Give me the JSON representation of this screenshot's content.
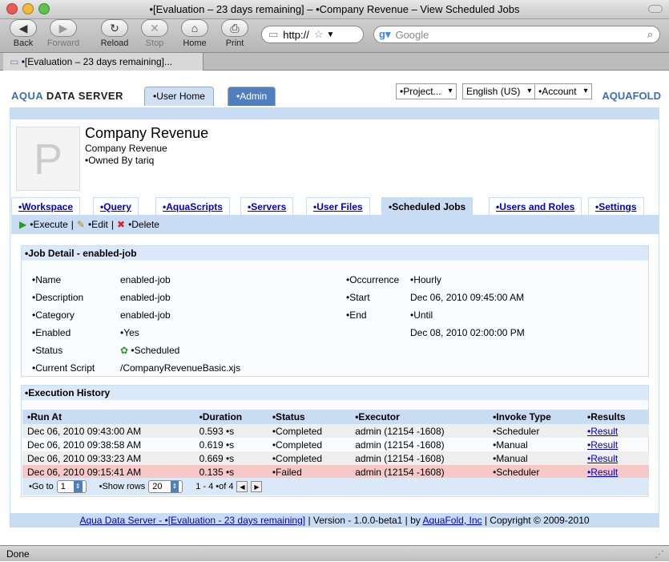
{
  "window": {
    "title": "•[Evaluation – 23 days remaining] – •Company Revenue – View Scheduled Jobs"
  },
  "browser": {
    "back": "Back",
    "forward": "Forward",
    "reload": "Reload",
    "stop": "Stop",
    "home": "Home",
    "print": "Print",
    "url": "http://",
    "search_placeholder": "Google",
    "tab_title": "•[Evaluation – 23 days remaining]...",
    "status": "Done"
  },
  "app": {
    "logo_prefix": "AQUA",
    "logo_suffix": " DATA SERVER",
    "brand_logo": "AQUAFOLD",
    "tabs": {
      "home": "•User Home",
      "admin": "•Admin"
    },
    "menus": {
      "project": "•Project...",
      "language": "English (US)",
      "account": "•Account"
    }
  },
  "project": {
    "avatar_letter": "P",
    "title": "Company Revenue",
    "subtitle": "Company Revenue",
    "owner": "•Owned By tariq"
  },
  "project_tabs": [
    {
      "label": "•Workspace"
    },
    {
      "label": "•Query"
    },
    {
      "label": "•AquaScripts"
    },
    {
      "label": "•Servers"
    },
    {
      "label": "•User Files"
    },
    {
      "label": "•Scheduled Jobs"
    },
    {
      "label": "•Users and Roles"
    },
    {
      "label": "•Settings"
    }
  ],
  "actions": {
    "execute": "•Execute",
    "edit": "•Edit",
    "delete": "•Delete",
    "sep": "|"
  },
  "job_detail": {
    "heading": "•Job Detail - enabled-job",
    "name_label": "•Name",
    "name_value": "enabled-job",
    "description_label": "•Description",
    "description_value": "enabled-job",
    "category_label": "•Category",
    "category_value": "enabled-job",
    "enabled_label": "•Enabled",
    "enabled_value": "•Yes",
    "status_label": "•Status",
    "status_value": "•Scheduled",
    "script_label": "•Current Script",
    "script_value": "/CompanyRevenueBasic.xjs",
    "occurrence_label": "•Occurrence",
    "occurrence_value": "•Hourly",
    "start_label": "•Start",
    "start_value": "Dec 06, 2010 09:45:00 AM",
    "end_label": "•End",
    "end_value": "•Until",
    "until_value": "Dec 08, 2010 02:00:00 PM"
  },
  "history": {
    "heading": "•Execution History",
    "columns": [
      "•Run At",
      "•Duration",
      "•Status",
      "•Executor",
      "•Invoke Type",
      "•Results"
    ],
    "rows": [
      {
        "run_at": "Dec 06, 2010 09:43:00 AM",
        "duration": "0.593 •s",
        "status": "•Completed",
        "executor": "admin (12154 -1608)",
        "invoke": "•Scheduler",
        "result": "•Result"
      },
      {
        "run_at": "Dec 06, 2010 09:38:58 AM",
        "duration": "0.619 •s",
        "status": "•Completed",
        "executor": "admin (12154 -1608)",
        "invoke": "•Manual",
        "result": "•Result"
      },
      {
        "run_at": "Dec 06, 2010 09:33:23 AM",
        "duration": "0.669 •s",
        "status": "•Completed",
        "executor": "admin (12154 -1608)",
        "invoke": "•Manual",
        "result": "•Result"
      },
      {
        "run_at": "Dec 06, 2010 09:15:41 AM",
        "duration": "0.135 •s",
        "status": "•Failed",
        "executor": "admin (12154 -1608)",
        "invoke": "•Scheduler",
        "result": "•Result"
      }
    ],
    "pager": {
      "goto_label": "•Go to",
      "goto_value": "1",
      "show_rows_label": "•Show rows",
      "show_rows_value": "20",
      "range": "1 - 4 •of 4"
    }
  },
  "footer": {
    "link_main": "Aqua Data Server - •[Evaluation - 23 days remaining]",
    "version": " | Version - 1.0.0-beta1 | by ",
    "link_company": "AquaFold, Inc",
    "copyright": " | Copyright © 2009-2010"
  },
  "colors": {
    "accent": "#c8dcf4",
    "admin_tab": "#4f7fbf",
    "failed_row": "#f6c8c8",
    "link": "#0000cc"
  }
}
